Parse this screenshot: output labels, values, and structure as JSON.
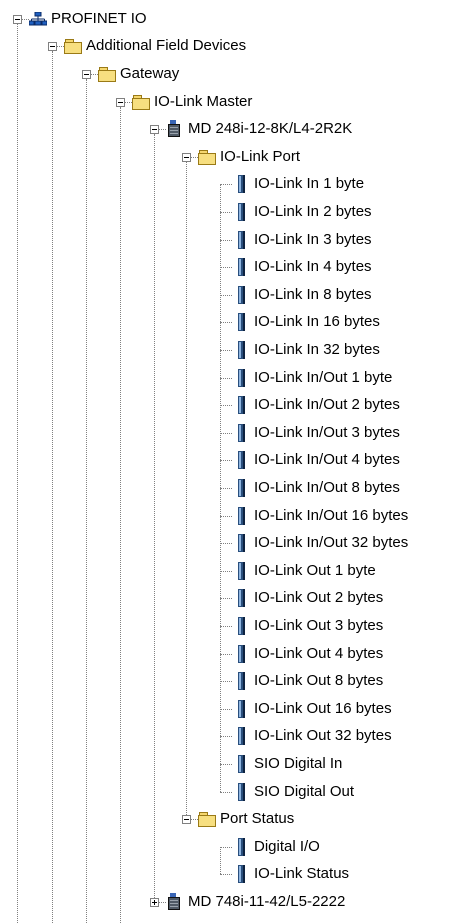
{
  "tree": {
    "root": {
      "label": "PROFINET IO",
      "icon": "network-icon",
      "expanded": true
    },
    "additional_field_devices": {
      "label": "Additional Field Devices",
      "icon": "folder-icon",
      "expanded": true
    },
    "gateway": {
      "label": "Gateway",
      "icon": "folder-icon",
      "expanded": true
    },
    "io_link_master": {
      "label": "IO-Link Master",
      "icon": "folder-icon",
      "expanded": true
    },
    "device_1": {
      "label": "MD 248i-12-8K/L4-2R2K",
      "icon": "device-icon",
      "expanded": true
    },
    "io_link_port": {
      "label": "IO-Link Port",
      "icon": "folder-icon",
      "expanded": true
    },
    "io_link_port_items": [
      "IO-Link In  1 byte",
      "IO-Link In  2 bytes",
      "IO-Link In  3 bytes",
      "IO-Link In  4 bytes",
      "IO-Link In  8 bytes",
      "IO-Link In 16 bytes",
      "IO-Link In 32 bytes",
      "IO-Link In/Out  1 byte",
      "IO-Link In/Out  2 bytes",
      "IO-Link In/Out  3 bytes",
      "IO-Link In/Out  4 bytes",
      "IO-Link In/Out  8 bytes",
      "IO-Link In/Out 16 bytes",
      "IO-Link In/Out 32 bytes",
      "IO-Link Out  1 byte",
      "IO-Link Out  2 bytes",
      "IO-Link Out  3 bytes",
      "IO-Link Out  4 bytes",
      "IO-Link Out  8 bytes",
      "IO-Link Out 16 bytes",
      "IO-Link Out 32 bytes",
      "SIO Digital In",
      "SIO Digital Out"
    ],
    "port_status": {
      "label": "Port Status",
      "icon": "folder-icon",
      "expanded": true
    },
    "port_status_items": [
      "Digital I/O",
      "IO-Link Status"
    ],
    "device_2": {
      "label": "MD 748i-11-42/L5-2222",
      "icon": "device-icon",
      "expanded": false
    }
  }
}
